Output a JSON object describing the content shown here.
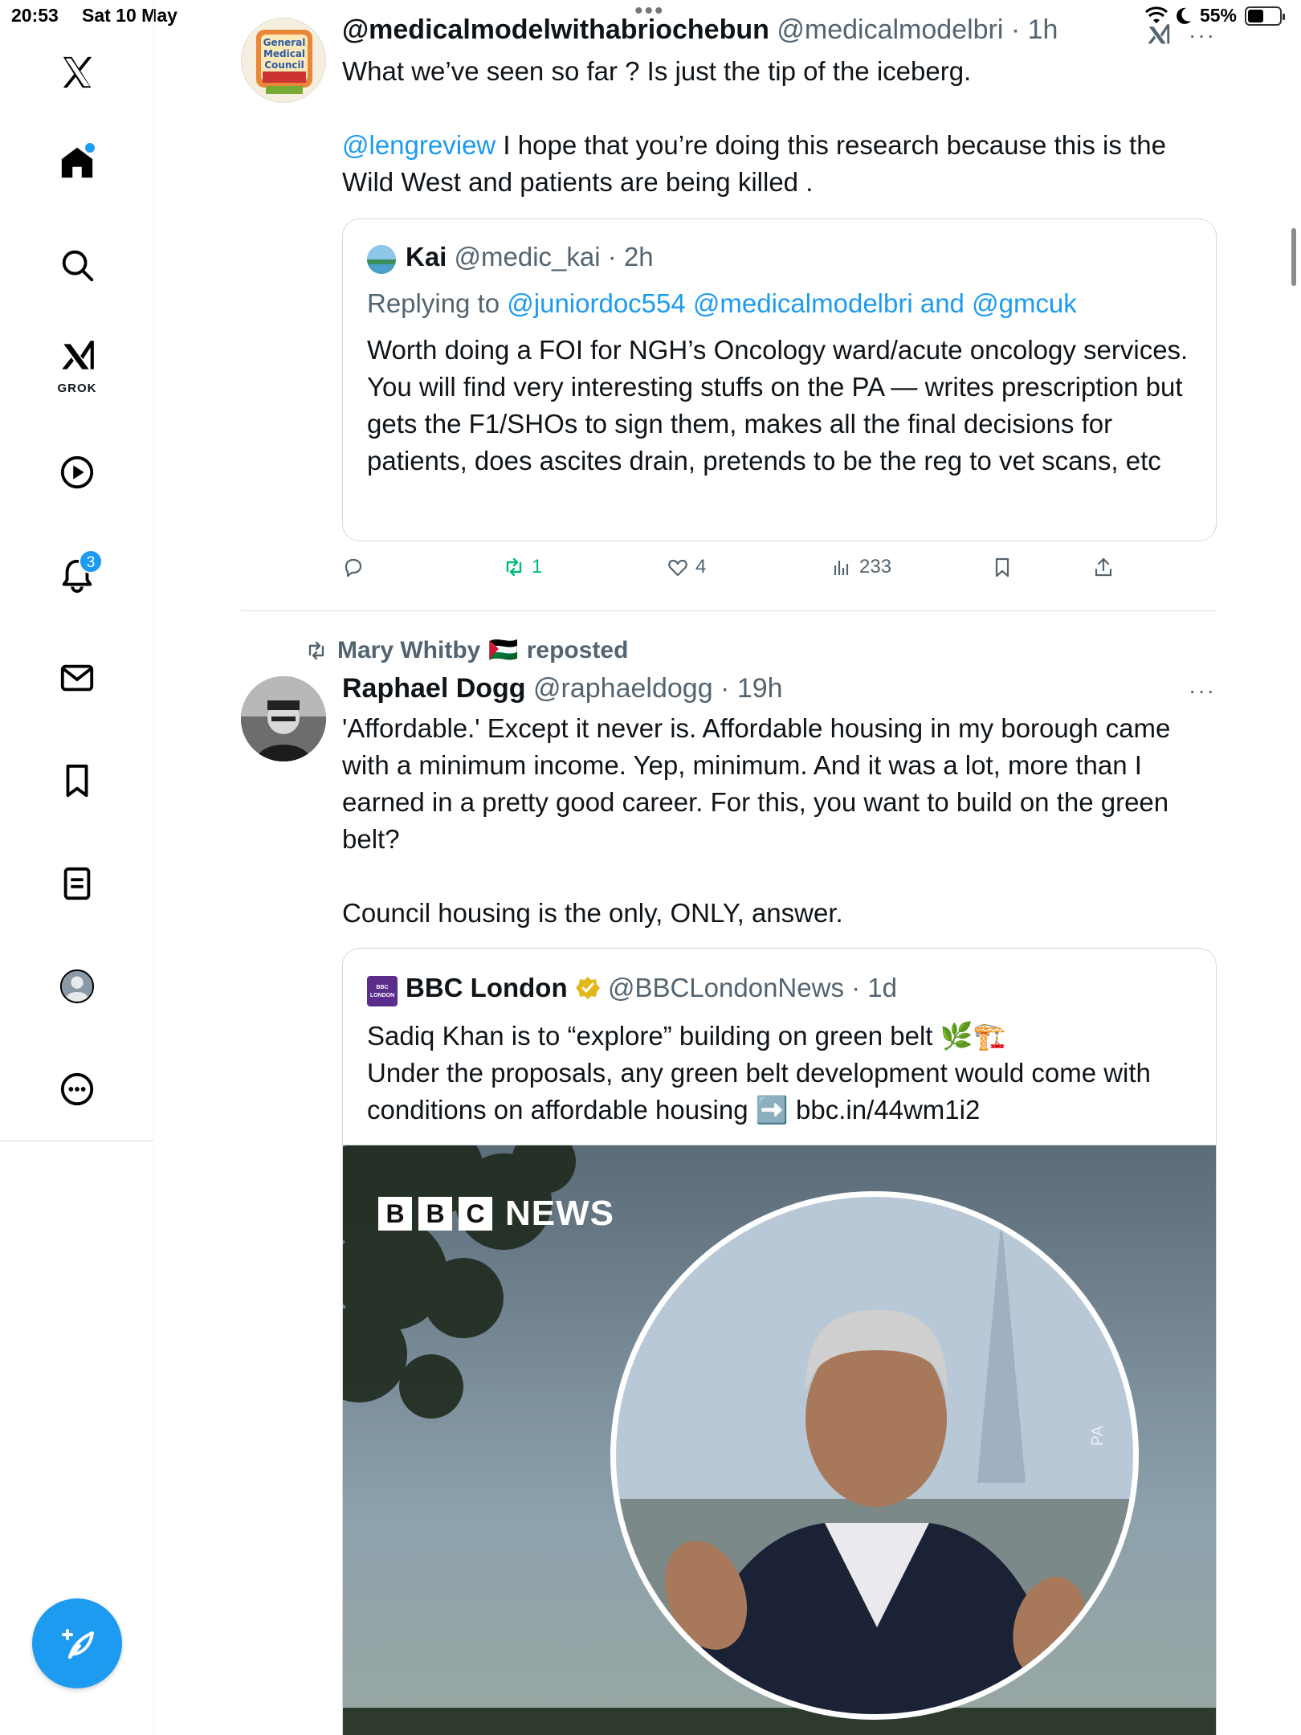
{
  "status": {
    "time": "20:53",
    "date": "Sat 10 May",
    "battery": "55%",
    "battery_level": 0.55
  },
  "nav": {
    "home_has_dot": true,
    "grok_label": "GROK",
    "notifications_count": "3"
  },
  "tweet1": {
    "display_name": "@medicalmodelwithabriochebun",
    "handle": "@medicalmodelbri",
    "time": "1h",
    "text_line1": "What we’ve seen so far ? Is just the tip of the iceberg.",
    "mention": "@lengreview",
    "text_line2": " I hope that you’re doing this research because this is the Wild West and patients are being killed .",
    "quote": {
      "display_name": "Kai",
      "handle": "@medic_kai",
      "time": "2h",
      "replying_prefix": "Replying to ",
      "replying_to": "@juniordoc554 @medicalmodelbri",
      "replying_and": " and ",
      "replying_last": "@gmcuk",
      "text": "Worth doing a FOI for NGH’s Oncology ward/acute oncology services. You will find very interesting stuffs on the PA — writes prescription but gets the F1/SHOs to sign them, makes all the final decisions for patients, does ascites drain, pretends to be the reg to vet scans, etc"
    },
    "actions": {
      "replies": "",
      "reposts": "1",
      "likes": "4",
      "views": "233"
    },
    "avatar_text": "General Medical Council"
  },
  "tweet2": {
    "reposted_by": "Mary Whitby",
    "reposted_flag": "🇵🇸",
    "reposted_label": "reposted",
    "display_name": "Raphael Dogg",
    "handle": "@raphaeldogg",
    "time": "19h",
    "text_para1": "'Affordable.' Except it never is. Affordable housing in my borough came with a minimum income. Yep, minimum. And it was a lot, more than I earned in a pretty good career. For this, you want to build on the green belt?",
    "text_para2": "Council housing is the only, ONLY, answer.",
    "quote": {
      "display_name": "BBC London",
      "handle": "@BBCLondonNews",
      "time": "1d",
      "avatar_text": "BBC LONDON",
      "line1": "Sadiq Khan is to “explore” building on green belt 🌿🏗️",
      "line2": "Under the proposals, any green belt development would come with conditions on affordable housing ➡️ bbc.in/44wm1i2",
      "media_brand": [
        "B",
        "B",
        "C"
      ],
      "media_news": "NEWS",
      "media_credit": "PA"
    }
  },
  "colors": {
    "accent": "#1d9bf0",
    "repost_green": "#00ba7c",
    "secondary_text": "#536471",
    "border": "#cfd9de"
  }
}
